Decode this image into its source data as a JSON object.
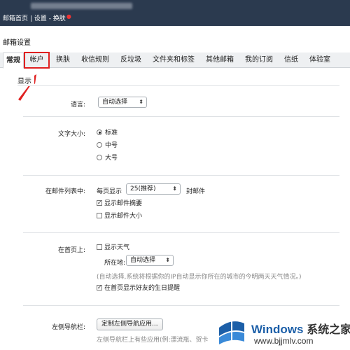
{
  "topbar": {
    "account_text": "@hotmail.com",
    "nav_home": "邮箱首页",
    "nav_settings": "设置",
    "nav_skin": "换肤"
  },
  "page_title": "邮箱设置",
  "tabs": [
    {
      "label": "常规",
      "active": true
    },
    {
      "label": "帐户",
      "highlighted": true
    },
    {
      "label": "换肤"
    },
    {
      "label": "收信规则"
    },
    {
      "label": "反垃圾"
    },
    {
      "label": "文件夹和标签"
    },
    {
      "label": "其他邮箱"
    },
    {
      "label": "我的订阅"
    },
    {
      "label": "信纸"
    },
    {
      "label": "体验室"
    }
  ],
  "section_title": "显示",
  "language": {
    "label": "语言:",
    "value": "自动选择"
  },
  "font_size": {
    "label": "文字大小:",
    "options": [
      "标准",
      "中号",
      "大号"
    ],
    "selected": "标准"
  },
  "mail_list": {
    "label": "在邮件列表中:",
    "per_page_prefix": "每页显示",
    "per_page_value": "25(推荐)",
    "per_page_suffix": "封邮件",
    "show_summary": "显示邮件摘要",
    "show_summary_checked": true,
    "show_size": "显示邮件大小",
    "show_size_checked": false
  },
  "home_page": {
    "label": "在首页上:",
    "show_weather": "显示天气",
    "show_weather_checked": false,
    "location_label": "所在地:",
    "location_value": "自动选择",
    "location_hint": "(自动选择,系统将根据你的IP自动显示你所在的城市的今明两天天气情况。)",
    "birthday_reminder": "在首页显示好友的生日提醒",
    "birthday_reminder_checked": true
  },
  "left_nav": {
    "label": "左侧导航栏:",
    "button": "定制左侧导航应用...",
    "hint": "左侧导航栏上有些应用(例:漂流瓶、贺卡"
  },
  "watermark": {
    "title": "Windows",
    "title_cn": "系统之家",
    "url": "www.bjjmlv.com",
    "brand_color": "#1c5fa8"
  }
}
